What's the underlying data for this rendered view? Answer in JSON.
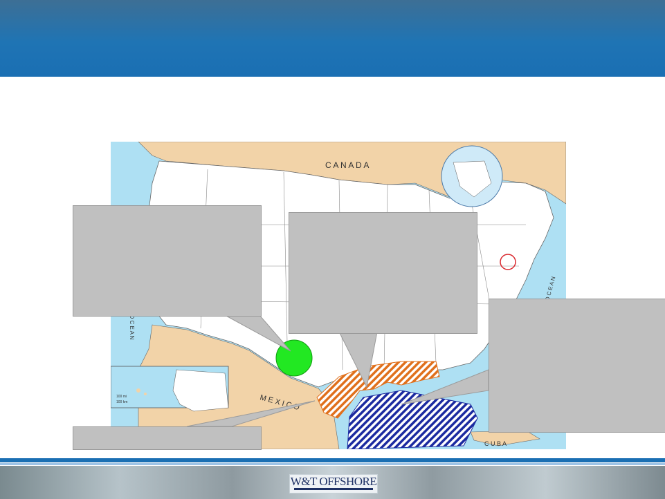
{
  "map": {
    "labels": {
      "canada": "C A N A D A",
      "mexico": "M E X I C O",
      "cuba": "C U B A",
      "atlantic": "T I C   O C E A N",
      "pacific": "O C E A N",
      "scale_top": "100 mi",
      "scale_bottom": "100 km"
    },
    "colors": {
      "land_foreign": "#f2d3a8",
      "land_us": "#ffffff",
      "water": "#aee0f3",
      "green_marker": "#22e822",
      "orange_hatch": "#e0701c",
      "blue_hatch": "#1b2aa0",
      "red_circle": "#d9262c"
    }
  },
  "callouts": [
    {
      "id": "top-left",
      "text": ""
    },
    {
      "id": "top-center",
      "text": ""
    },
    {
      "id": "right",
      "text": ""
    },
    {
      "id": "bottom-left",
      "text": ""
    }
  ],
  "footer": {
    "logo_text": "W&T OFFSHORE"
  }
}
